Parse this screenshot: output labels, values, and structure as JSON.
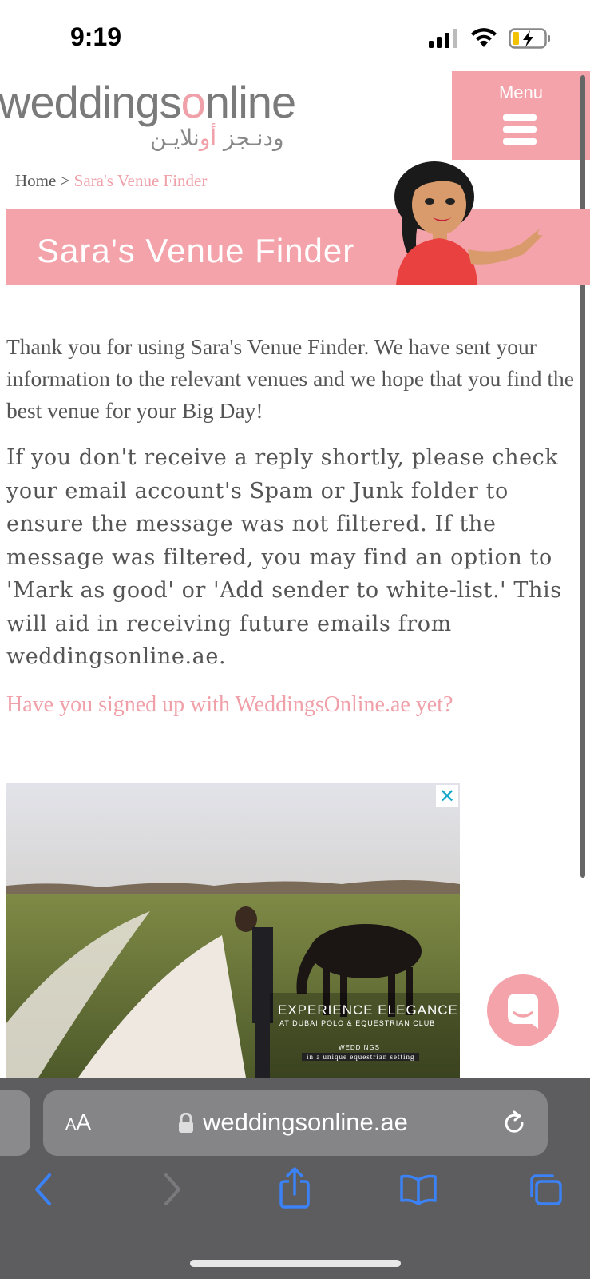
{
  "status": {
    "time": "9:19"
  },
  "header": {
    "logo_text_before": "weddings",
    "logo_text_o": "o",
    "logo_text_after": "nline",
    "logo_arabic_pre": "ودنـجز ",
    "logo_arabic_pink": "أو",
    "logo_arabic_post": "نلايـن",
    "menu_label": "Menu"
  },
  "breadcrumb": {
    "home": "Home",
    "separator": " > ",
    "current": "Sara's Venue Finder"
  },
  "banner": {
    "title": "Sara's Venue Finder"
  },
  "content": {
    "paragraph1": "Thank you for using Sara's Venue Finder. We have sent your information to the relevant venues and we hope that you find the best venue for your Big Day!",
    "paragraph2": "If you don't receive a reply shortly, please check your email account's Spam or Junk folder to ensure the message was not filtered. If the message was filtered, you may find an option to 'Mark as good' or 'Add sender to white-list.' This will aid in receiving future emails from weddingsonline.ae.",
    "signup_link": "Have you signed up with WeddingsOnline.ae yet?"
  },
  "ad": {
    "close": "✕",
    "headline": "EXPERIENCE ELEGANCE",
    "subline": "AT DUBAI POLO & EQUESTRIAN CLUB",
    "label": "WEDDINGS",
    "tagline": "in a unique equestrian setting"
  },
  "safari": {
    "text_size": "AA",
    "url": "weddingsonline.ae"
  },
  "colors": {
    "brand_pink": "#f4a3ab",
    "safari_blue": "#3b82f6"
  }
}
